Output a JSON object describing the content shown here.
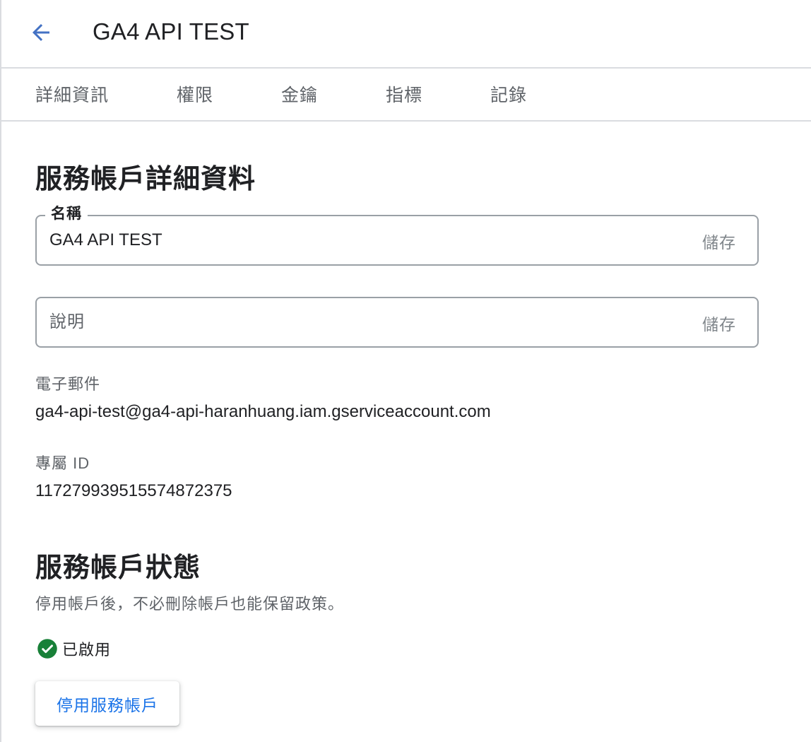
{
  "header": {
    "title": "GA4 API TEST",
    "back_icon": "arrow-back-icon"
  },
  "tabs": [
    {
      "label": "詳細資訊"
    },
    {
      "label": "權限"
    },
    {
      "label": "金鑰"
    },
    {
      "label": "指標"
    },
    {
      "label": "記錄"
    }
  ],
  "details": {
    "heading": "服務帳戶詳細資料",
    "name_field": {
      "label": "名稱",
      "value": "GA4 API TEST",
      "save_label": "儲存"
    },
    "description_field": {
      "placeholder": "說明",
      "value": "",
      "save_label": "儲存"
    },
    "email": {
      "label": "電子郵件",
      "value": "ga4-api-test@ga4-api-haranhuang.iam.gserviceaccount.com"
    },
    "unique_id": {
      "label": "專屬 ID",
      "value": "117279939515574872375"
    }
  },
  "status": {
    "heading": "服務帳戶狀態",
    "description": "停用帳戶後，不必刪除帳戶也能保留政策。",
    "state_icon": "check-circle-icon",
    "state_label": "已啟用",
    "disable_button": "停用服務帳戶"
  },
  "colors": {
    "accent": "#1a73e8",
    "back_arrow": "#4472c4",
    "enabled_green": "#188038",
    "border": "#dadce0"
  }
}
